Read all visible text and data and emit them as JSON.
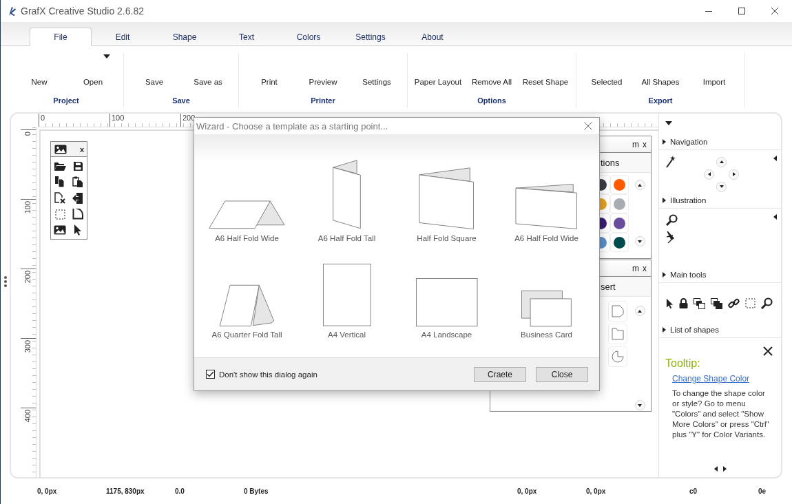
{
  "window": {
    "title": "GrafX Creative Studio 2.6.82"
  },
  "tabs": [
    {
      "label": "File",
      "selected": true
    },
    {
      "label": "Edit",
      "selected": false
    },
    {
      "label": "Shape",
      "selected": false
    },
    {
      "label": "Text",
      "selected": false
    },
    {
      "label": "Colors",
      "selected": false
    },
    {
      "label": "Settings",
      "selected": false
    },
    {
      "label": "About",
      "selected": false
    }
  ],
  "ribbon": {
    "groups": [
      {
        "label": "Project",
        "buttons": [
          {
            "label": "New",
            "menu": false
          },
          {
            "label": "Open",
            "menu": true
          }
        ]
      },
      {
        "label": "Save",
        "buttons": [
          {
            "label": "Save",
            "menu": false
          },
          {
            "label": "Save as",
            "menu": false
          }
        ]
      },
      {
        "label": "Printer",
        "buttons": [
          {
            "label": "Print",
            "menu": false
          },
          {
            "label": "Preview",
            "menu": false
          },
          {
            "label": "Settings",
            "menu": false
          }
        ]
      },
      {
        "label": "Options",
        "buttons": [
          {
            "label": "Paper Layout",
            "menu": false
          },
          {
            "label": "Remove All",
            "menu": false
          },
          {
            "label": "Reset Shape",
            "menu": false
          }
        ]
      },
      {
        "label": "Export",
        "buttons": [
          {
            "label": "Selected",
            "menu": false
          },
          {
            "label": "All Shapes",
            "menu": false
          },
          {
            "label": "Import",
            "menu": false
          }
        ]
      }
    ]
  },
  "rulers": {
    "horizontal": [
      "0",
      "100",
      "200"
    ],
    "vertical": [
      "0",
      "100",
      "200",
      "300",
      "400"
    ]
  },
  "toolbox": {
    "close": "x"
  },
  "color_panel": {
    "buttons": [
      "m",
      "x"
    ],
    "title": "tions",
    "swatches": [
      {
        "color": "#3a3f45"
      },
      {
        "color": "#ff5a00"
      },
      {
        "color": "#e8a21c"
      },
      {
        "color": "#a9adb2"
      },
      {
        "color": "#3b1f73"
      },
      {
        "color": "#6a4c9c"
      },
      {
        "color": "#5a8fd0"
      },
      {
        "color": "#004b4b"
      }
    ]
  },
  "insert_panel": {
    "buttons": [
      "m",
      "x"
    ],
    "title": "sert"
  },
  "dialog": {
    "title": "Wizard - Choose a template as a starting point...",
    "templates": [
      {
        "label": "A6 Half Fold Wide",
        "kind": "tent"
      },
      {
        "label": "A6 Half Fold Tall",
        "kind": "tall"
      },
      {
        "label": "Half Fold Square",
        "kind": "square"
      },
      {
        "label": "A6 Half Fold Wide",
        "kind": "wide"
      },
      {
        "label": "A6 Quarter Fold Tall",
        "kind": "quarter"
      },
      {
        "label": "A4 Vertical",
        "kind": "a4v"
      },
      {
        "label": "A4 Landscape",
        "kind": "a4l"
      },
      {
        "label": "Business Card",
        "kind": "card"
      }
    ],
    "checkbox": {
      "label": "Don't show this dialog again",
      "checked": true
    },
    "buttons": [
      "Craete",
      "Close"
    ]
  },
  "sidebar": {
    "sections": [
      {
        "label": "Navigation",
        "kind": "navigation"
      },
      {
        "label": "Illustration",
        "kind": "illustration"
      },
      {
        "label": "Main tools",
        "kind": "tools"
      },
      {
        "label": "List of shapes",
        "kind": "list"
      }
    ]
  },
  "tooltip": {
    "title": "Tooltip:",
    "link": "Change Shape Color",
    "text": "To change the shape color or style? Go to menu \"Colors\" and select \"Show More Colors\" or press \"Ctrl\" plus \"Y\" for Color Variants."
  },
  "status_bar": [
    "0, 0px",
    "1175, 830px",
    "0.0",
    "0 Bytes",
    "0, 0px",
    "0, 0px",
    "c0",
    "0e"
  ]
}
